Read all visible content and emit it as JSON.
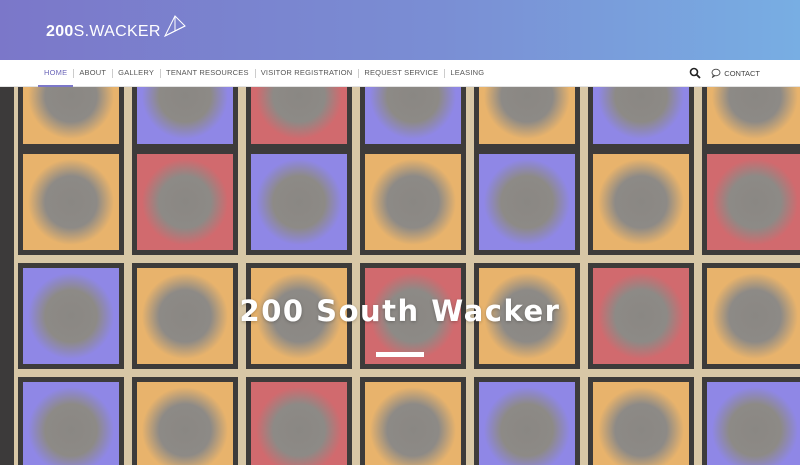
{
  "site": {
    "logo_bold": "200",
    "logo_light": "S.WACKER",
    "brand_color": "#7b77c9"
  },
  "nav": {
    "items": [
      {
        "label": "HOME",
        "active": true
      },
      {
        "label": "ABOUT"
      },
      {
        "label": "GALLERY"
      },
      {
        "label": "TENANT RESOURCES"
      },
      {
        "label": "VISITOR REGISTRATION"
      },
      {
        "label": "REQUEST SERVICE"
      },
      {
        "label": "LEASING"
      }
    ],
    "search_icon": "search-icon",
    "contact_label": "CONTACT",
    "contact_icon": "chat-bubble-icon"
  },
  "hero": {
    "title": "200 South Wacker",
    "tile_colors": {
      "amber": "#e8b36c",
      "red": "#d16a6e",
      "blue": "#8f87e6"
    }
  }
}
